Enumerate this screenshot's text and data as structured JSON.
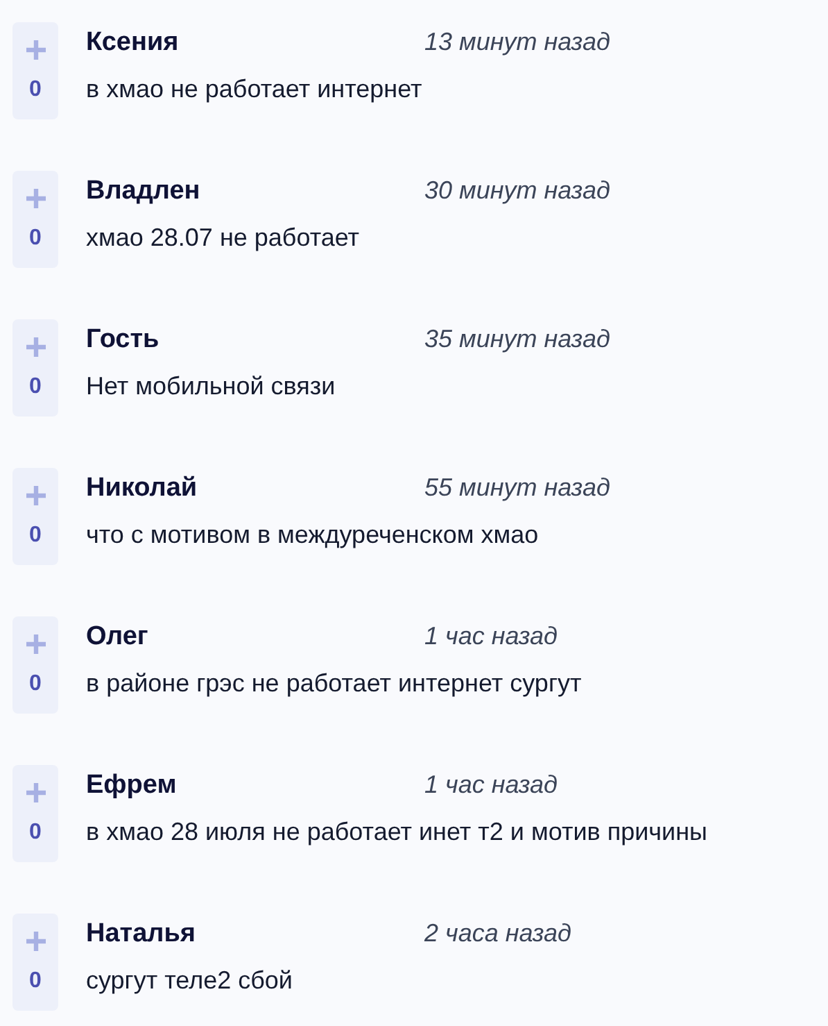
{
  "comments": [
    {
      "author": "Ксения",
      "time": "13 минут назад",
      "text": "в хмао не работает интернет",
      "votes": "0"
    },
    {
      "author": "Владлен",
      "time": "30 минут назад",
      "text": "хмао 28.07 не работает",
      "votes": "0"
    },
    {
      "author": "Гость",
      "time": "35 минут назад",
      "text": "Нет мобильной связи",
      "votes": "0"
    },
    {
      "author": "Николай",
      "time": "55 минут назад",
      "text": "что с мотивом в междуреченском хмао",
      "votes": "0"
    },
    {
      "author": "Олег",
      "time": "1 час назад",
      "text": "в районе грэс не работает интернет сургут",
      "votes": "0"
    },
    {
      "author": "Ефрем",
      "time": "1 час назад",
      "text": "в хмао 28 июля не работает инет т2 и мотив причины",
      "votes": "0"
    },
    {
      "author": "Наталья",
      "time": "2 часа назад",
      "text": "сургут теле2 сбой",
      "votes": "0"
    }
  ]
}
